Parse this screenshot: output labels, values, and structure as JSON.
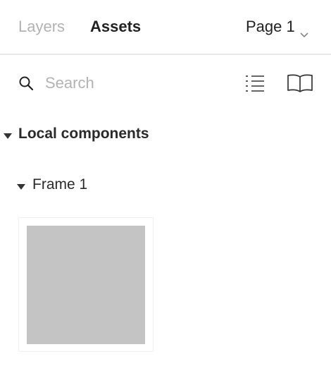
{
  "header": {
    "tabs": [
      {
        "label": "Layers",
        "active": false
      },
      {
        "label": "Assets",
        "active": true
      }
    ],
    "page_selector": {
      "label": "Page 1",
      "icon": "chevron-down-icon"
    }
  },
  "search": {
    "placeholder": "Search",
    "value": "",
    "icons": [
      "search-icon",
      "list-view-icon",
      "library-book-icon"
    ]
  },
  "library": {
    "section_title": "Local components",
    "groups": [
      {
        "title": "Frame 1",
        "components": [
          {
            "thumbnail_color": "#c4c4c4"
          }
        ]
      }
    ]
  }
}
